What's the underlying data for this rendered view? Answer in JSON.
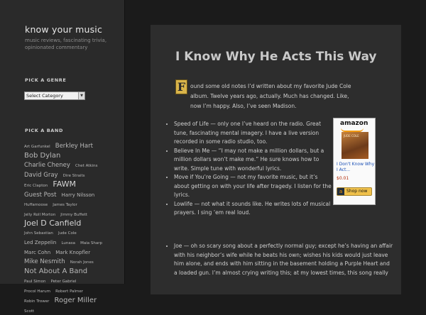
{
  "site": {
    "title": "know your music",
    "description": "music reviews, fascinating trivia, opinionated commentary"
  },
  "sidebar": {
    "genre_widget_title": "PICK A GENRE",
    "genre_select_value": "Select Category",
    "band_widget_title": "PICK A BAND",
    "tags": [
      {
        "label": "Art Garfunkel",
        "size": 1
      },
      {
        "label": "Berkley Hart",
        "size": 3
      },
      {
        "label": "Bob Dylan",
        "size": 4
      },
      {
        "label": "Charlie Cheney",
        "size": 3
      },
      {
        "label": "Chet Atkins",
        "size": 1
      },
      {
        "label": "David Gray",
        "size": 3
      },
      {
        "label": "Dire Straits",
        "size": 1
      },
      {
        "label": "Eric Clapton",
        "size": 1
      },
      {
        "label": "FAWM",
        "size": 5
      },
      {
        "label": "Guest Post",
        "size": 3
      },
      {
        "label": "Harry Nilsson",
        "size": 2
      },
      {
        "label": "Huffamoose",
        "size": 1
      },
      {
        "label": "James Taylor",
        "size": 1
      },
      {
        "label": "Jelly Roll Morton",
        "size": 1
      },
      {
        "label": "Jimmy Buffett",
        "size": 1
      },
      {
        "label": "Joel D Canfield",
        "size": 5
      },
      {
        "label": "John Sebastian",
        "size": 1
      },
      {
        "label": "Jude Cole",
        "size": 1
      },
      {
        "label": "Led Zeppelin",
        "size": 2
      },
      {
        "label": "Lunasa",
        "size": 1
      },
      {
        "label": "Maia Sharp",
        "size": 1
      },
      {
        "label": "Marc Cohn",
        "size": 2
      },
      {
        "label": "Mark Knopfler",
        "size": 2
      },
      {
        "label": "Mike Nesmith",
        "size": 3
      },
      {
        "label": "Norah Jones",
        "size": 1
      },
      {
        "label": "Not About A Band",
        "size": 4
      },
      {
        "label": "Paul Simon",
        "size": 1
      },
      {
        "label": "Peter Gabriel",
        "size": 1
      },
      {
        "label": "Procol Harum",
        "size": 1
      },
      {
        "label": "Robert Palmer",
        "size": 1
      },
      {
        "label": "Robin Trower",
        "size": 1
      },
      {
        "label": "Roger Miller",
        "size": 4
      },
      {
        "label": "Scott",
        "size": 1
      }
    ]
  },
  "post": {
    "title": "I Know Why He Acts This Way",
    "dropcap": "F",
    "intro": "ound some old notes I’d written about my favorite Jude Cole album. Twelve years ago, actually. Much has changed. Like, now I’m happy. Also, I’ve seen Madison.",
    "bullets": [
      "Speed of Life — only one I’ve heard on the radio. Great tune, fascinating mental imagery. I have a live version recorded in some radio studio, too.",
      "Believe In Me — “I may not make a million dollars, but a million dollars won’t make me.” He sure knows how to write. Simple tune with wonderful lyrics.",
      "Move if You’re Going — not my favorite music, but it’s about getting on with your life after tragedy. I listen for the lyrics.",
      "Lowlife — not what it sounds like. He writes lots of musical prayers. I sing ’em real loud."
    ],
    "bullets_wide": [
      "Joe — oh so scary song about a perfectly normal guy; except he’s having an affair with his neighbor’s wife while he beats his own; wishes his kids would just leave him alone, and ends with him sitting in the basement holding a Purple Heart and a loaded gun. I’m almost crying writing this; at my lowest times, this song really"
    ]
  },
  "ad": {
    "brand": "amazon",
    "cover_label": "JUDE COLE",
    "product_title": "I Don't Know Why I Act...",
    "price": "$0.01",
    "shop_label": "Shop now",
    "logo_glyph": "a"
  }
}
